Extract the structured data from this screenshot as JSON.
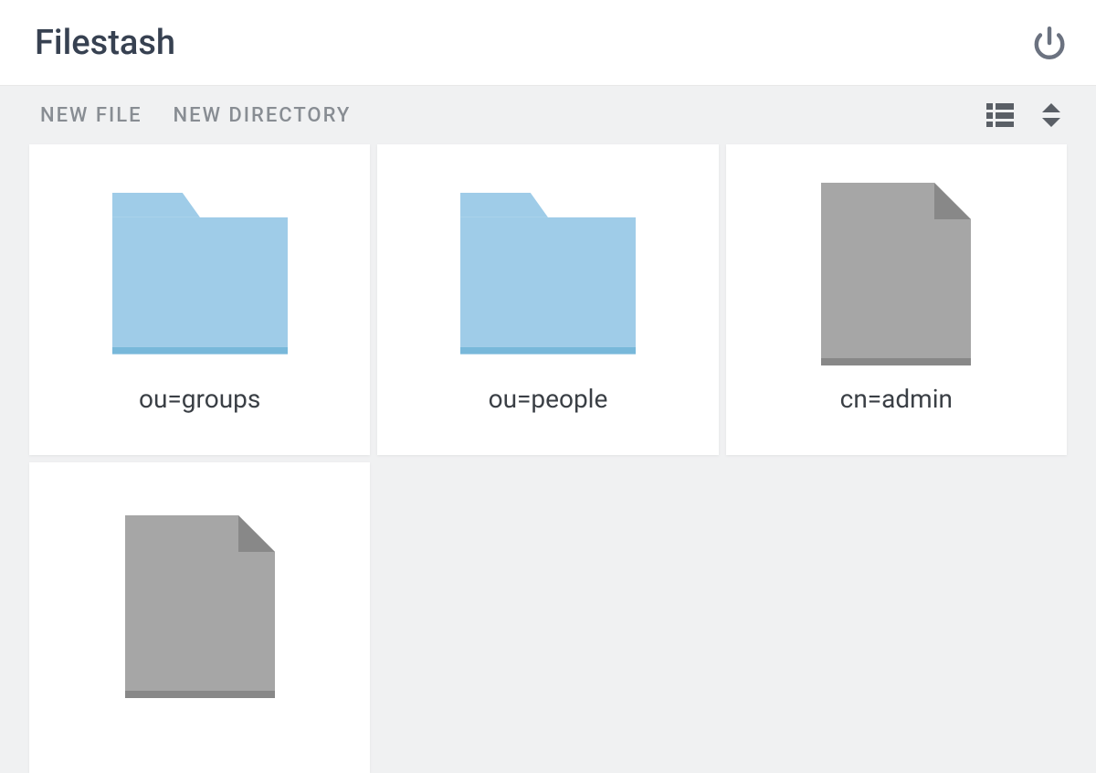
{
  "header": {
    "title": "Filestash"
  },
  "toolbar": {
    "new_file_label": "NEW FILE",
    "new_directory_label": "NEW DIRECTORY"
  },
  "items": [
    {
      "type": "folder",
      "name": "ou=groups"
    },
    {
      "type": "folder",
      "name": "ou=people"
    },
    {
      "type": "file",
      "name": "cn=admin"
    },
    {
      "type": "file",
      "name": ""
    }
  ]
}
